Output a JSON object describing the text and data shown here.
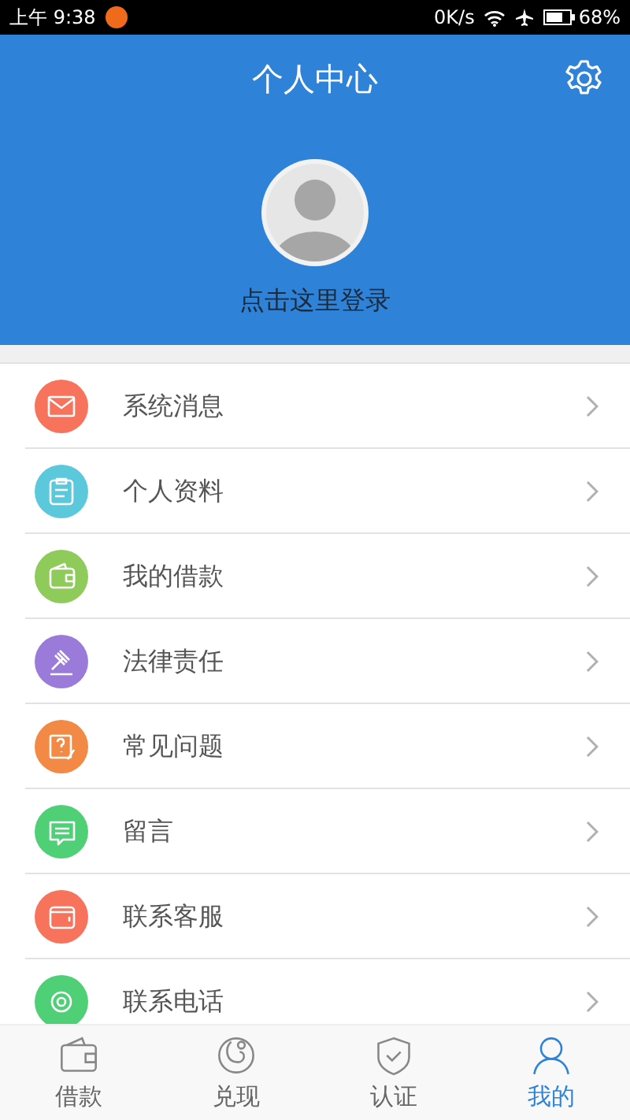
{
  "status_bar": {
    "time": "上午 9:38",
    "speed": "0K/s",
    "battery": "68%"
  },
  "header": {
    "title": "个人中心",
    "login_prompt": "点击这里登录"
  },
  "menu": [
    {
      "label": "系统消息",
      "color": "#f7735c"
    },
    {
      "label": "个人资料",
      "color": "#5bc8dc"
    },
    {
      "label": "我的借款",
      "color": "#8fcb5a"
    },
    {
      "label": "法律责任",
      "color": "#9b7bd9"
    },
    {
      "label": "常见问题",
      "color": "#f28a45"
    },
    {
      "label": "留言",
      "color": "#4fcf76"
    },
    {
      "label": "联系客服",
      "color": "#f7735c"
    },
    {
      "label": "联系电话",
      "color": "#4fcf76"
    }
  ],
  "tabs": [
    {
      "label": "借款",
      "selected": false
    },
    {
      "label": "兑现",
      "selected": false
    },
    {
      "label": "认证",
      "selected": false
    },
    {
      "label": "我的",
      "selected": true
    }
  ]
}
